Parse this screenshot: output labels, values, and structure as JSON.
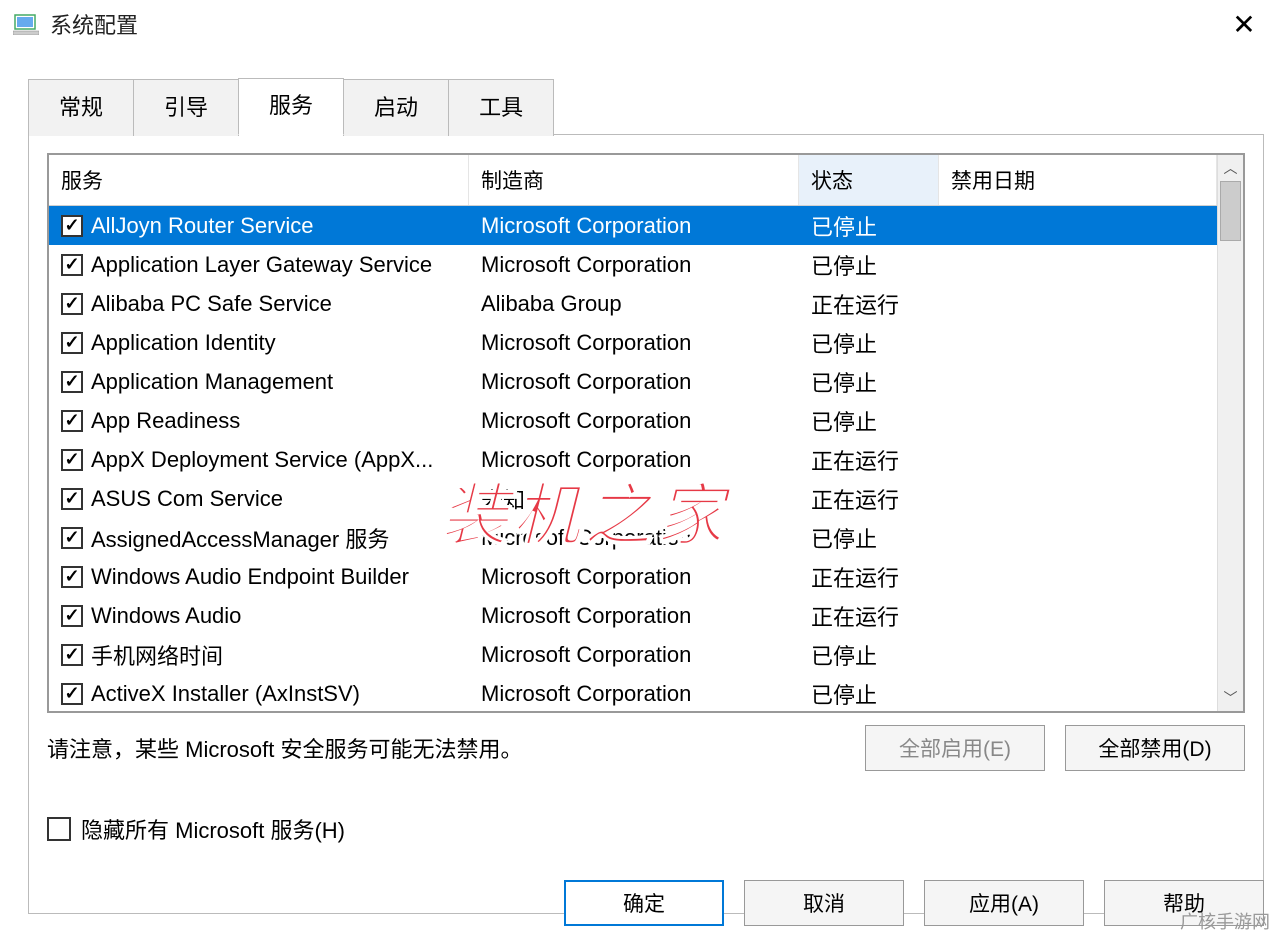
{
  "window": {
    "title": "系统配置",
    "close": "✕"
  },
  "tabs": {
    "items": [
      {
        "label": "常规",
        "active": false
      },
      {
        "label": "引导",
        "active": false
      },
      {
        "label": "服务",
        "active": true
      },
      {
        "label": "启动",
        "active": false
      },
      {
        "label": "工具",
        "active": false
      }
    ]
  },
  "columns": {
    "service": "服务",
    "manufacturer": "制造商",
    "status": "状态",
    "disabled_date": "禁用日期"
  },
  "services": [
    {
      "checked": true,
      "selected": true,
      "name": "AllJoyn Router Service",
      "mfr": "Microsoft Corporation",
      "status": "已停止",
      "date": ""
    },
    {
      "checked": true,
      "selected": false,
      "name": "Application Layer Gateway Service",
      "mfr": "Microsoft Corporation",
      "status": "已停止",
      "date": ""
    },
    {
      "checked": true,
      "selected": false,
      "name": "Alibaba PC Safe Service",
      "mfr": "Alibaba Group",
      "status": "正在运行",
      "date": ""
    },
    {
      "checked": true,
      "selected": false,
      "name": "Application Identity",
      "mfr": "Microsoft Corporation",
      "status": "已停止",
      "date": ""
    },
    {
      "checked": true,
      "selected": false,
      "name": "Application Management",
      "mfr": "Microsoft Corporation",
      "status": "已停止",
      "date": ""
    },
    {
      "checked": true,
      "selected": false,
      "name": "App Readiness",
      "mfr": "Microsoft Corporation",
      "status": "已停止",
      "date": ""
    },
    {
      "checked": true,
      "selected": false,
      "name": "AppX Deployment Service (AppX...",
      "mfr": "Microsoft Corporation",
      "status": "正在运行",
      "date": ""
    },
    {
      "checked": true,
      "selected": false,
      "name": "ASUS Com Service",
      "mfr": "未知",
      "status": "正在运行",
      "date": ""
    },
    {
      "checked": true,
      "selected": false,
      "name": "AssignedAccessManager 服务",
      "mfr": "Microsoft Corporation",
      "status": "已停止",
      "date": ""
    },
    {
      "checked": true,
      "selected": false,
      "name": "Windows Audio Endpoint Builder",
      "mfr": "Microsoft Corporation",
      "status": "正在运行",
      "date": ""
    },
    {
      "checked": true,
      "selected": false,
      "name": "Windows Audio",
      "mfr": "Microsoft Corporation",
      "status": "正在运行",
      "date": ""
    },
    {
      "checked": true,
      "selected": false,
      "name": "手机网络时间",
      "mfr": "Microsoft Corporation",
      "status": "已停止",
      "date": ""
    },
    {
      "checked": true,
      "selected": false,
      "name": "ActiveX Installer (AxInstSV)",
      "mfr": "Microsoft Corporation",
      "status": "已停止",
      "date": ""
    }
  ],
  "note": "请注意，某些 Microsoft 安全服务可能无法禁用。",
  "enable_all": "全部启用(E)",
  "disable_all": "全部禁用(D)",
  "hide_ms": "隐藏所有 Microsoft 服务(H)",
  "hide_ms_checked": false,
  "buttons": {
    "ok": "确定",
    "cancel": "取消",
    "apply": "应用(A)",
    "help": "帮助"
  },
  "watermark": "装机之家",
  "corner_watermark": "广核手游网"
}
